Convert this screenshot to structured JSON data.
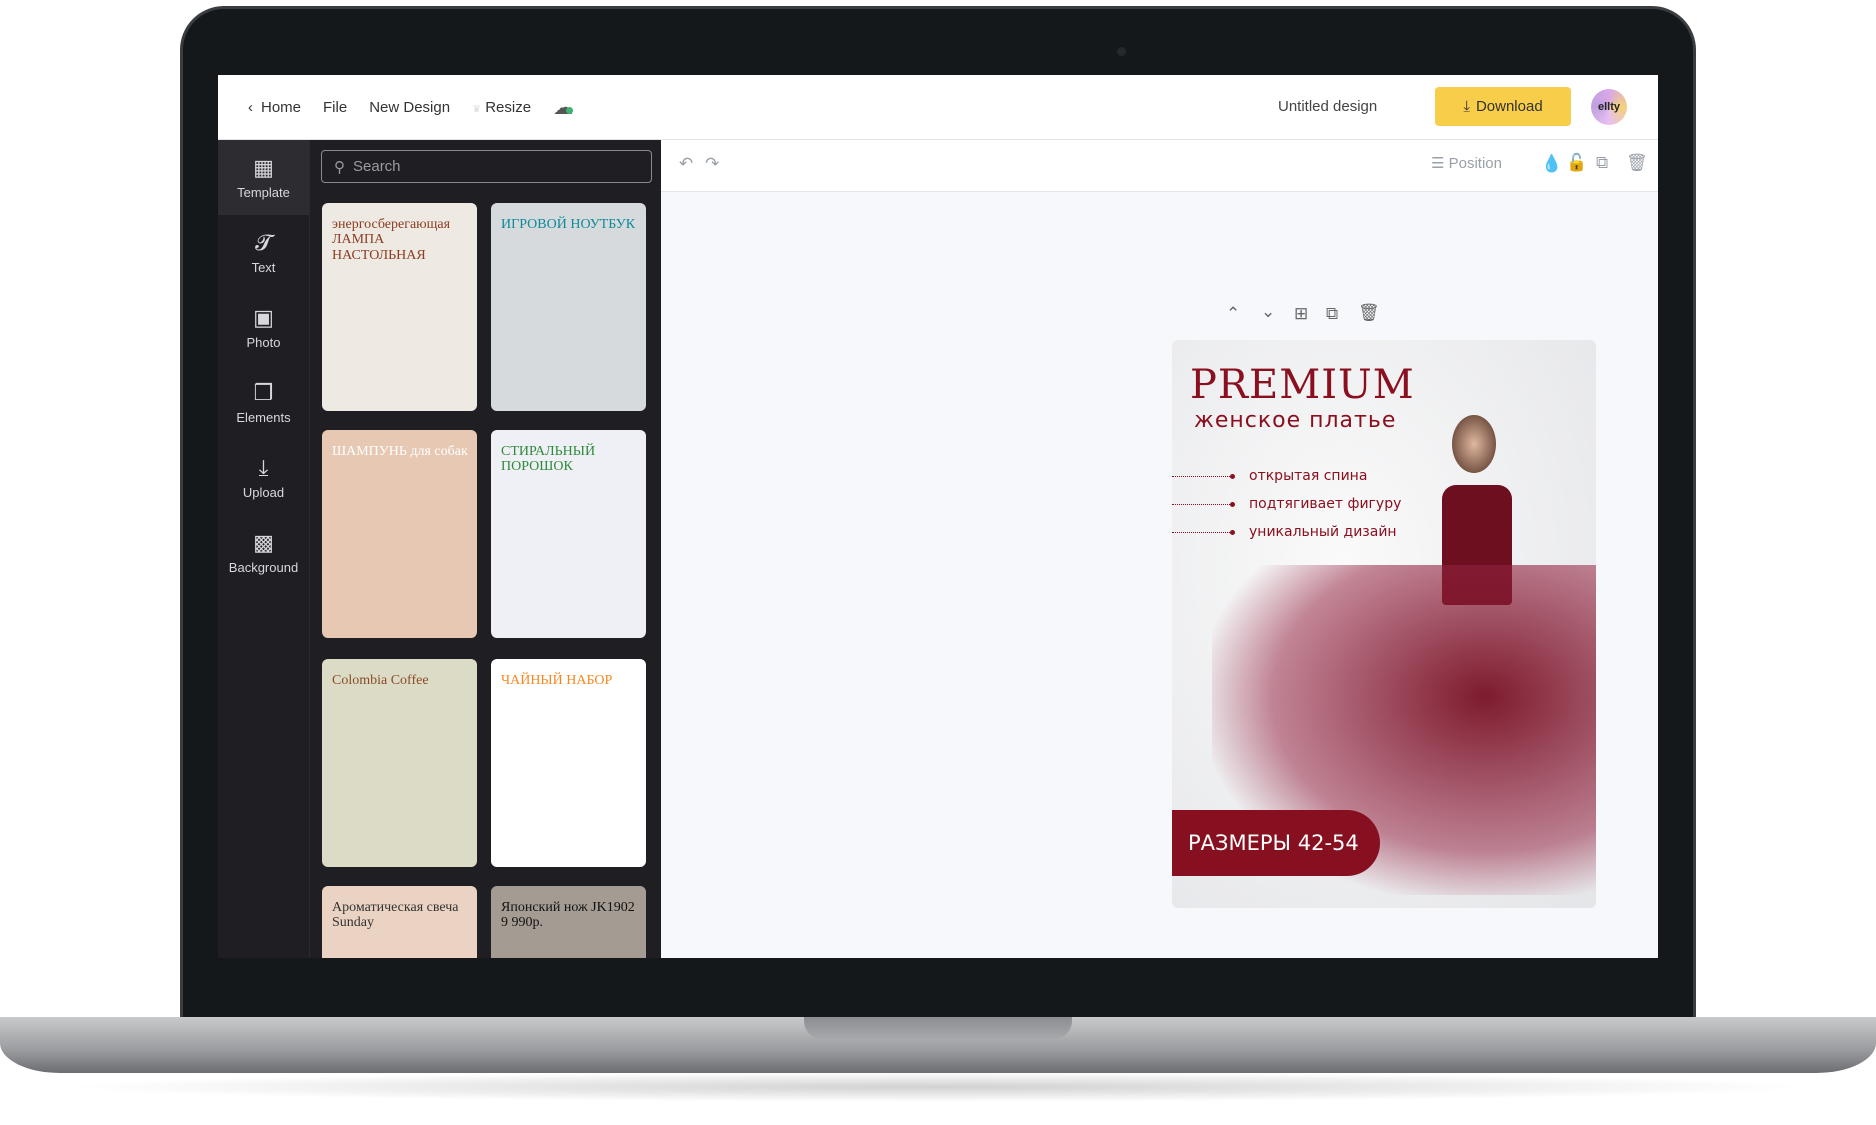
{
  "topbar": {
    "home": "Home",
    "file": "File",
    "new_design": "New Design",
    "resize": "Resize",
    "title": "Untitled design",
    "download": "Download",
    "avatar": "ellty"
  },
  "rail": [
    {
      "label": "Template",
      "icon": "grid-icon"
    },
    {
      "label": "Text",
      "icon": "text-icon"
    },
    {
      "label": "Photo",
      "icon": "image-icon"
    },
    {
      "label": "Elements",
      "icon": "elements-icon"
    },
    {
      "label": "Upload",
      "icon": "upload-icon"
    },
    {
      "label": "Background",
      "icon": "background-icon"
    }
  ],
  "search": {
    "placeholder": "Search"
  },
  "templates": [
    {
      "title": "энергосберегающая ЛАМПА НАСТОЛЬНАЯ",
      "bg": "#efe9e4",
      "color": "#8a3d1f"
    },
    {
      "title": "ИГРОВОЙ НОУТБУК",
      "bg": "#d7dadd",
      "color": "#0e8a9a"
    },
    {
      "title": "ШАМПУНЬ для собак",
      "bg": "#e6c8b3",
      "color": "#ffffff"
    },
    {
      "title": "СТИРАЛЬНЫЙ ПОРОШОК",
      "bg": "#eef0f6",
      "color": "#2f8a3a"
    },
    {
      "title": "Colombia Coffee",
      "bg": "#dcdcc6",
      "color": "#8a4b2a"
    },
    {
      "title": "ЧАЙНЫЙ НАБОР",
      "bg": "#ffffff",
      "color": "#f7881f"
    },
    {
      "title": "Ароматическая свеча Sunday",
      "bg": "#ebd3c3",
      "color": "#333333"
    },
    {
      "title": "Японский нож JK1902 9 990р.",
      "bg": "#a49c92",
      "color": "#111111"
    }
  ],
  "toolbar": {
    "position": "Position"
  },
  "design": {
    "headline": "PREMIUM",
    "subheadline": "женское платье",
    "bullets": [
      "открытая спина",
      "подтягивает фигуру",
      "уникальный дизайн"
    ],
    "sizes": "РАЗМЕРЫ 42-54",
    "accent": "#861020"
  }
}
